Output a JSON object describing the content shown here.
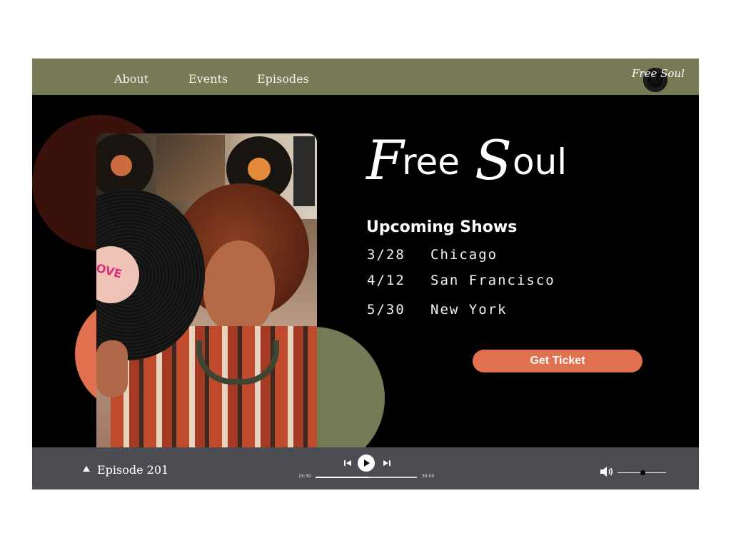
{
  "nav": {
    "items": [
      {
        "label": "About"
      },
      {
        "label": "Events"
      },
      {
        "label": "Episodes"
      }
    ],
    "logo_text": "Free Soul"
  },
  "hero": {
    "brand": {
      "F": "F",
      "ree": "ree",
      "S": "S",
      "oul": "oul"
    },
    "shows_title": "Upcoming Shows",
    "shows": [
      {
        "date": "3/28",
        "city": "Chicago"
      },
      {
        "date": "4/12",
        "city": "San Francisco"
      },
      {
        "date": "5/30",
        "city": "New York"
      }
    ],
    "ticket_label": "Get Ticket",
    "photo_record_label": "LOVE"
  },
  "player": {
    "episode": "Episode 201",
    "time_current": "15:30",
    "time_total": "30:00",
    "progress_fraction": 0.52,
    "volume_fraction": 0.52
  },
  "colors": {
    "nav_bg": "#777a55",
    "accent_orange": "#e0704f",
    "olive": "#767a56",
    "dark_red": "#3a120b",
    "player_bg": "#4c4d52"
  },
  "icons": [
    "vinyl-logo-icon",
    "chevron-up-icon",
    "skip-previous-icon",
    "play-icon",
    "skip-next-icon",
    "volume-icon"
  ]
}
